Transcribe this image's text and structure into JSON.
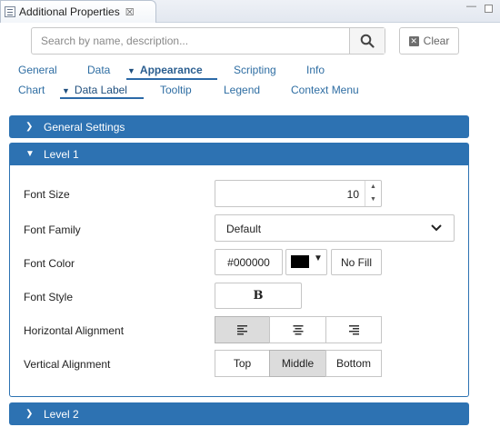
{
  "window": {
    "title": "Additional Properties",
    "close_glyph": "☒",
    "min_glyph": "—"
  },
  "search": {
    "placeholder": "Search by name, description...",
    "value": "",
    "clear_label": "Clear"
  },
  "tabs": {
    "primary": [
      "General",
      "Data",
      "Appearance",
      "Scripting",
      "Info"
    ],
    "primary_active": "Appearance",
    "secondary": [
      "Chart",
      "Data Label",
      "Tooltip",
      "Legend",
      "Context Menu"
    ],
    "secondary_active": "Data Label"
  },
  "sections": {
    "general_settings": {
      "title": "General Settings",
      "expanded": false
    },
    "level1": {
      "title": "Level 1",
      "expanded": true
    },
    "level2": {
      "title": "Level 2",
      "expanded": false
    }
  },
  "fields": {
    "font_size": {
      "label": "Font Size",
      "value": "10"
    },
    "font_family": {
      "label": "Font Family",
      "value": "Default"
    },
    "font_color": {
      "label": "Font Color",
      "value": "#000000",
      "swatch": "#000000",
      "no_fill_label": "No Fill"
    },
    "font_style": {
      "label": "Font Style",
      "bold_label": "B"
    },
    "horizontal_alignment": {
      "label": "Horizontal Alignment",
      "options": [
        "left",
        "center",
        "right"
      ],
      "selected": "left"
    },
    "vertical_alignment": {
      "label": "Vertical Alignment",
      "options": [
        "Top",
        "Middle",
        "Bottom"
      ],
      "selected": "Middle"
    }
  },
  "colors": {
    "accent": "#2d72b2",
    "link": "#2f6ea3",
    "selected_segment": "#dcdcdc"
  },
  "icons": {
    "search": "search-icon",
    "clear": "clear-x-icon",
    "collapsed_chevron": "chevron-right-icon",
    "expanded_chevron": "chevron-down-icon",
    "dropdown": "chevron-down-icon"
  }
}
